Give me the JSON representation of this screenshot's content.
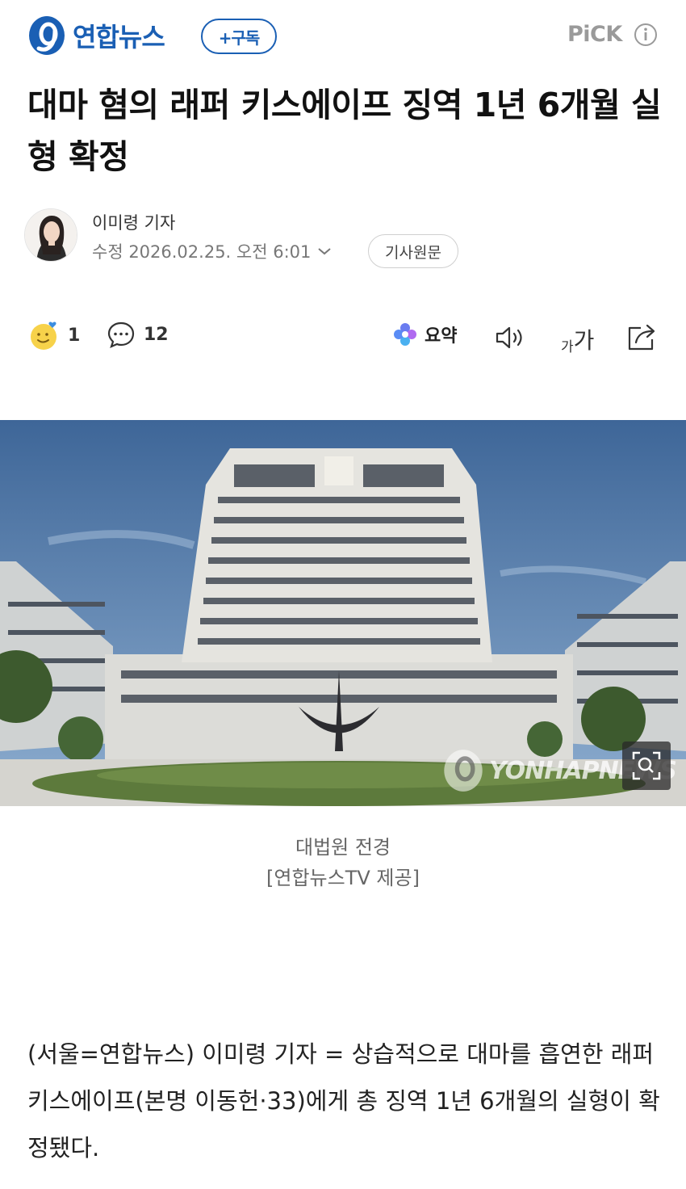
{
  "header": {
    "logo_text": "연합뉴스",
    "subscribe_label": "+구독",
    "pick_label": "PiCK",
    "accent_color": "#1a5fb4"
  },
  "article": {
    "headline": "대마 혐의 래퍼 키스에이프 징역 1년 6개월 실형 확정",
    "reporter": "이미령 기자",
    "dateline": "수정 2026.02.25. 오전 6:01",
    "original_button": "기사원문"
  },
  "actions": {
    "reaction_count": "1",
    "comment_count": "12",
    "summary_label": "요약",
    "font_size_label_small": "가",
    "font_size_label_large": "가"
  },
  "photo": {
    "watermark_text": "YONHAPNEWS",
    "caption_line1": "대법원 전경",
    "caption_line2": "[연합뉴스TV 제공]"
  },
  "body": {
    "paragraph": "(서울=연합뉴스) 이미령 기자 = 상습적으로 대마를 흡연한 래퍼 키스에이프(본명 이동헌·33)에게 총 징역 1년 6개월의 실형이 확정됐다."
  },
  "icons": {
    "logo": "yonhap-logo-icon",
    "info": "info-icon",
    "reaction": "smile-heart-icon",
    "comment": "comment-icon",
    "summary": "sparkle-icon",
    "audio": "speaker-icon",
    "share": "share-icon",
    "zoom": "zoom-icon",
    "chevron": "chevron-down-icon"
  }
}
